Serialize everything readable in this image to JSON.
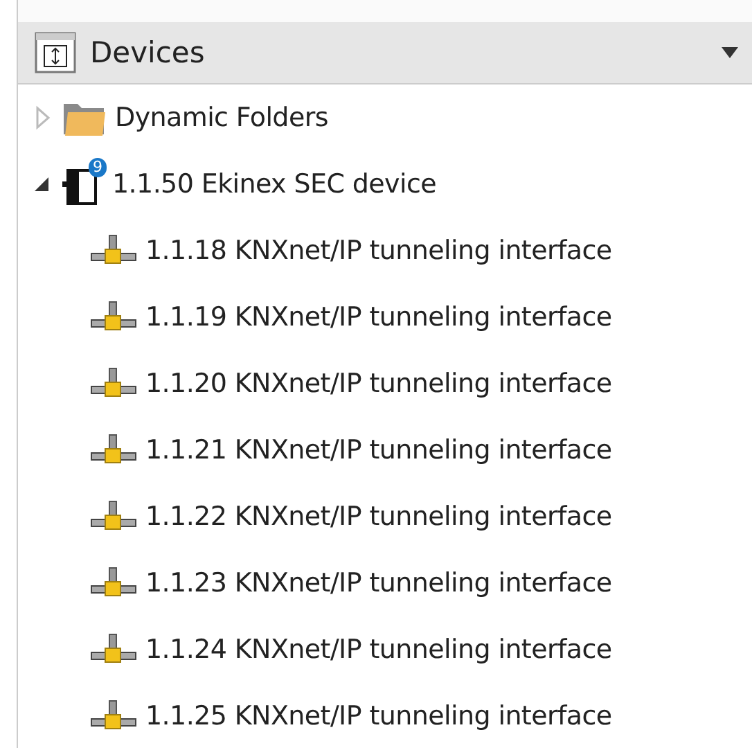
{
  "panel": {
    "title": "Devices"
  },
  "tree": [
    {
      "label": "Dynamic Folders",
      "kind": "folder",
      "expanded": false
    },
    {
      "label": "1.1.50 Ekinex SEC device",
      "kind": "device",
      "badge": "9",
      "expanded": true,
      "children": [
        {
          "label": "1.1.18 KNXnet/IP tunneling interface",
          "kind": "tunnel"
        },
        {
          "label": "1.1.19 KNXnet/IP tunneling interface",
          "kind": "tunnel"
        },
        {
          "label": "1.1.20 KNXnet/IP tunneling interface",
          "kind": "tunnel"
        },
        {
          "label": "1.1.21 KNXnet/IP tunneling interface",
          "kind": "tunnel"
        },
        {
          "label": "1.1.22 KNXnet/IP tunneling interface",
          "kind": "tunnel"
        },
        {
          "label": "1.1.23 KNXnet/IP tunneling interface",
          "kind": "tunnel"
        },
        {
          "label": "1.1.24 KNXnet/IP tunneling interface",
          "kind": "tunnel"
        },
        {
          "label": "1.1.25 KNXnet/IP tunneling interface",
          "kind": "tunnel"
        }
      ]
    }
  ]
}
